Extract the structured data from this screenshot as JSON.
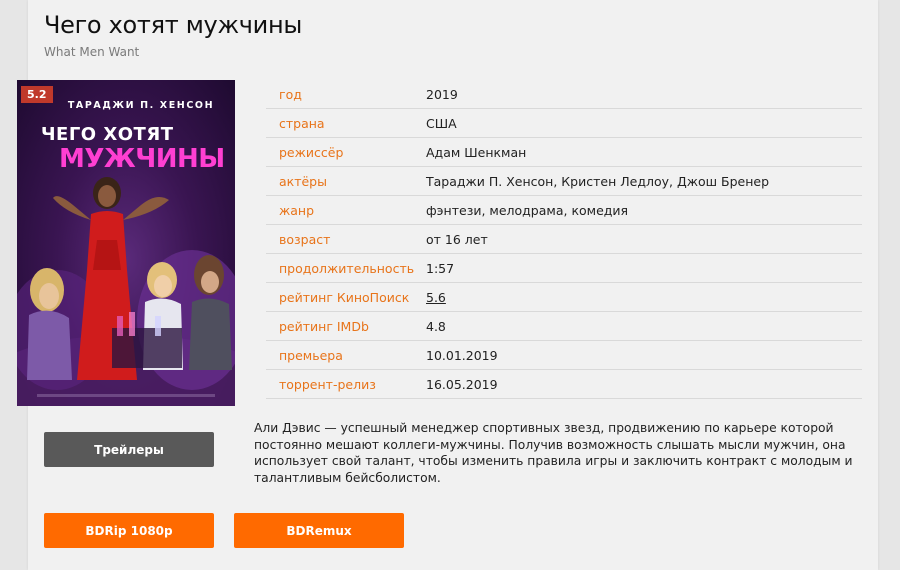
{
  "movie": {
    "title": "Чего хотят мужчины",
    "original_title": "What Men Want",
    "poster": {
      "rating_badge": "5.2",
      "actor_line": "ТАРАДЖИ П. ХЕНСОН",
      "title_line1": "ЧЕГО ХОТЯТ",
      "title_line2": "МУЖЧИНЫ",
      "badge_color": "#c0392b",
      "accent_color": "#ff3fd2"
    },
    "info": [
      {
        "label": "год",
        "value": "2019"
      },
      {
        "label": "страна",
        "value": "США"
      },
      {
        "label": "режиссёр",
        "value": "Адам Шенкман"
      },
      {
        "label": "актёры",
        "value": "Тараджи П. Хенсон, Кристен Ледлоу, Джош Бренер"
      },
      {
        "label": "жанр",
        "value": "фэнтези, мелодрама, комедия"
      },
      {
        "label": "возраст",
        "value": "от 16 лет"
      },
      {
        "label": "продолжительность",
        "value": "1:57"
      },
      {
        "label": "рейтинг КиноПоиск",
        "value": "5.6"
      },
      {
        "label": "рейтинг IMDb",
        "value": "4.8"
      },
      {
        "label": "премьера",
        "value": "10.01.2019"
      },
      {
        "label": "торрент-релиз",
        "value": "16.05.2019"
      }
    ],
    "description": "Али Дэвис — успешный менеджер спортивных звезд, продвижению по карьере которой постоянно мешают коллеги-мужчины. Получив возможность слышать мысли мужчин, она использует свой талант, чтобы изменить правила игры и заключить контракт с молодым и талантливым бейсболистом."
  },
  "buttons": {
    "trailers": "Трейлеры",
    "download1": "BDRip 1080p",
    "download2": "BDRemux"
  },
  "colors": {
    "label": "#e8741a",
    "download_button": "#ff6a00",
    "trailer_button": "#595959"
  }
}
